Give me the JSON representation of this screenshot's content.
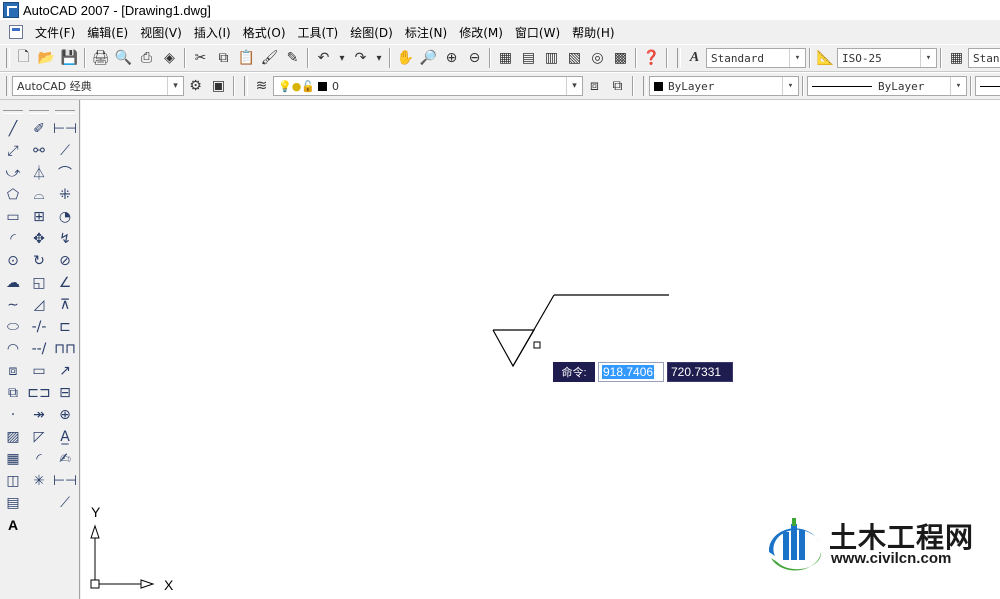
{
  "window": {
    "title": "AutoCAD 2007 - [Drawing1.dwg]"
  },
  "menu": [
    "文件(F)",
    "编辑(E)",
    "视图(V)",
    "插入(I)",
    "格式(O)",
    "工具(T)",
    "绘图(D)",
    "标注(N)",
    "修改(M)",
    "窗口(W)",
    "帮助(H)"
  ],
  "toolbar1": {
    "text_style": "Standard",
    "dim_style": "ISO-25",
    "table_style": "Standard"
  },
  "toolbar2": {
    "workspace": "AutoCAD 经典",
    "layer": "0",
    "color": "ByLayer",
    "linetype": "ByLayer"
  },
  "dynamic_input": {
    "prompt": "命令:",
    "x_value": "918.7406",
    "y_value": "720.7331"
  },
  "ucs": {
    "x_label": "X",
    "y_label": "Y"
  },
  "watermark": {
    "name": "土木工程网",
    "url": "www.civilcn.com"
  },
  "colors": {
    "canvas": "#ffffff",
    "dyn_input_bg": "#1f1d4f",
    "selection": "#3399ff",
    "logo_blue": "#1a73c8",
    "logo_green": "#3fa535"
  }
}
